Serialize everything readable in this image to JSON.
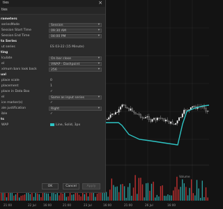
{
  "window": {
    "title": "ties",
    "sub_header": "ties"
  },
  "properties": [
    {
      "label": "rameters",
      "type": "section"
    },
    {
      "label": "seriesMode",
      "value": "Session",
      "type": "dropdown"
    },
    {
      "label": "Session Start Time",
      "value": "09:30 AM",
      "type": "dropdown"
    },
    {
      "label": "Session End Time",
      "value": "04:00 PM",
      "type": "dropdown"
    },
    {
      "label": "ta Series",
      "type": "section"
    },
    {
      "label": "ut series",
      "value": "ES 03-22 (15 Minute)",
      "type": "text"
    },
    {
      "label": "ting",
      "type": "section"
    },
    {
      "label": "lculate",
      "value": "On bar close",
      "type": "dropdown"
    },
    {
      "label": "el",
      "value": "VWAP - Dashpoint",
      "type": "dropdown"
    },
    {
      "label": "ximum bars look back",
      "value": "256",
      "type": "dropdown"
    },
    {
      "label": "ual",
      "type": "section"
    },
    {
      "label": "place scale",
      "value": "0",
      "type": "text"
    },
    {
      "label": "placement",
      "value": "1",
      "type": "text"
    },
    {
      "label": "place in Data Box",
      "value": "✓",
      "type": "text"
    },
    {
      "label": "el",
      "value": "Same as input series",
      "type": "dropdown"
    },
    {
      "label": "ice marker(s)",
      "value": "✓",
      "type": "text"
    },
    {
      "label": "ale justification",
      "value": "Right",
      "type": "dropdown"
    },
    {
      "label": "ible",
      "value": "✓",
      "type": "text"
    },
    {
      "label": "ts",
      "type": "section"
    },
    {
      "label": "WAP",
      "value": "Line, Solid, 3px",
      "type": "swatch"
    }
  ],
  "buttons": {
    "ok": "OK",
    "cancel": "Cancel",
    "apply": "Apply"
  },
  "chart": {
    "volume_label": "Volume",
    "x_ticks": [
      "21:00",
      "22 Jul",
      "16:00",
      "21:00",
      "23 Jul",
      "16:00",
      "21:00",
      "26 Jul",
      "16:00"
    ],
    "colors": {
      "background": "#131313",
      "grid": "#2a2a2a",
      "up_candle": "#ffffff",
      "down_candle": "#3a3a3a",
      "vwap": "#2ec4c4",
      "volume_red": "#c03030",
      "volume_teal": "#2a9a9a"
    }
  }
}
